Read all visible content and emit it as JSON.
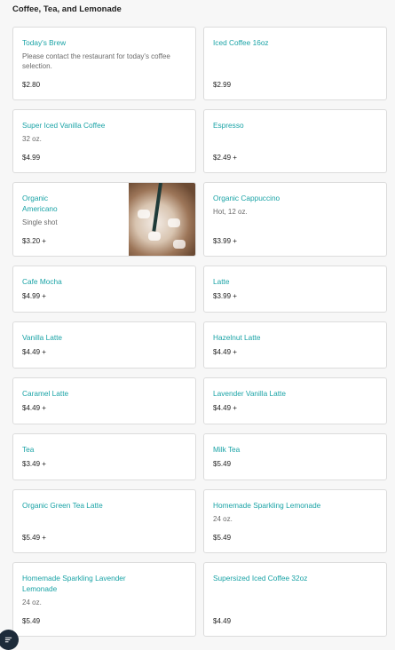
{
  "section": {
    "title": "Coffee, Tea, and Lemonade"
  },
  "items": [
    {
      "name": "Today's Brew",
      "description": "Please contact the restaurant for today's coffee selection.",
      "price": "$2.80"
    },
    {
      "name": "Iced Coffee 16oz",
      "description": "",
      "price": "$2.99"
    },
    {
      "name": "Super Iced Vanilla Coffee",
      "description": "32 oz.",
      "price": "$4.99"
    },
    {
      "name": "Espresso",
      "description": "",
      "price": "$2.49 +"
    },
    {
      "name": "Organic Americano",
      "description": "Single shot",
      "price": "$3.20 +"
    },
    {
      "name": "Organic Cappuccino",
      "description": "Hot, 12 oz.",
      "price": "$3.99 +"
    },
    {
      "name": "Cafe Mocha",
      "description": "",
      "price": "$4.99 +"
    },
    {
      "name": "Latte",
      "description": "",
      "price": "$3.99 +"
    },
    {
      "name": "Vanilla Latte",
      "description": "",
      "price": "$4.49 +"
    },
    {
      "name": "Hazelnut Latte",
      "description": "",
      "price": "$4.49 +"
    },
    {
      "name": "Caramel Latte",
      "description": "",
      "price": "$4.49 +"
    },
    {
      "name": "Lavender Vanilla Latte",
      "description": "",
      "price": "$4.49 +"
    },
    {
      "name": "Tea",
      "description": "",
      "price": "$3.49 +"
    },
    {
      "name": "Milk Tea",
      "description": "",
      "price": "$5.49"
    },
    {
      "name": "Organic Green Tea Latte",
      "description": "",
      "price": "$5.49 +"
    },
    {
      "name": "Homemade Sparkling Lemonade",
      "description": "24 oz.",
      "price": "$5.49"
    },
    {
      "name": "Homemade Sparkling Lavender Lemonade",
      "description": "24 oz.",
      "price": "$5.49"
    },
    {
      "name": "Supersized Iced Coffee 32oz",
      "description": "",
      "price": "$4.49"
    }
  ],
  "colors": {
    "item_name": "#1aa3a6",
    "fab_background": "#1d2b3a"
  },
  "icons": {
    "filter_button": "filter-icon"
  }
}
